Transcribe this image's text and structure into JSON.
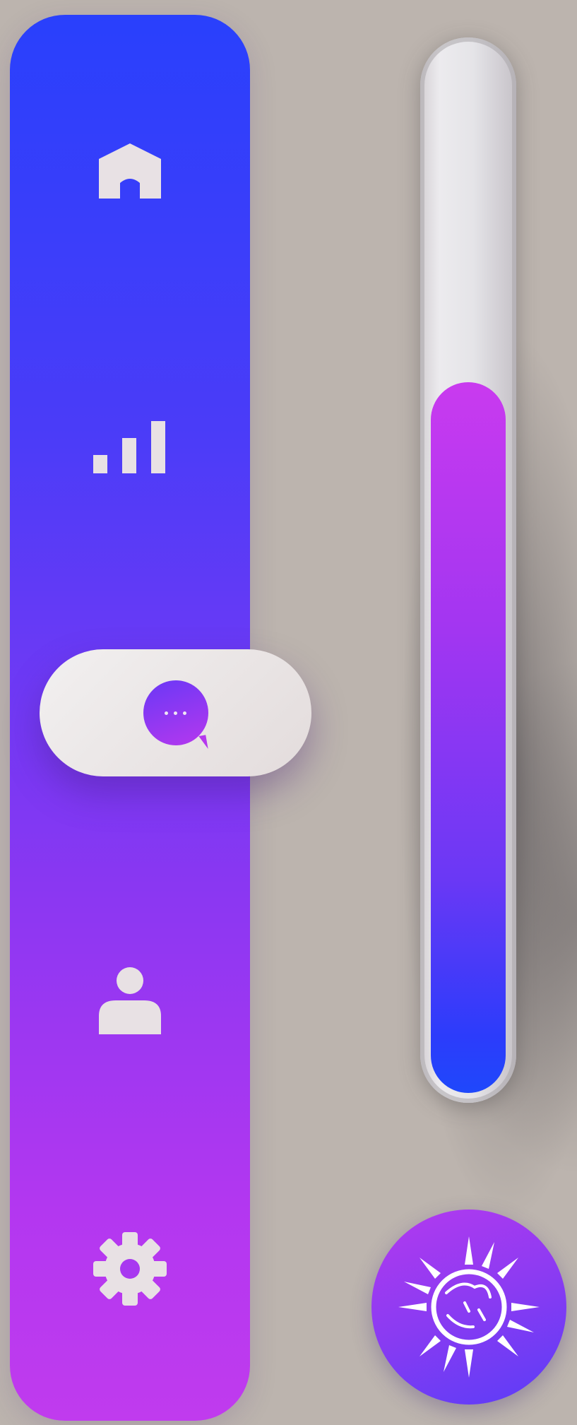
{
  "sidebar": {
    "gradient_top": "#2940fc",
    "gradient_bottom": "#c03bee",
    "items": [
      {
        "id": "home",
        "icon": "home-icon",
        "active": false
      },
      {
        "id": "stats",
        "icon": "signal-bars-icon",
        "active": false
      },
      {
        "id": "messages",
        "icon": "chat-bubble-icon",
        "active": true
      },
      {
        "id": "profile",
        "icon": "user-icon",
        "active": false
      },
      {
        "id": "settings",
        "icon": "gear-icon",
        "active": false
      }
    ]
  },
  "slider": {
    "orientation": "vertical",
    "value_fraction": 0.68,
    "fill_gradient_top": "#c93aef",
    "fill_gradient_bottom": "#1f48fb"
  },
  "sun_button": {
    "icon": "sun-icon",
    "color": "#8a3bf2"
  }
}
